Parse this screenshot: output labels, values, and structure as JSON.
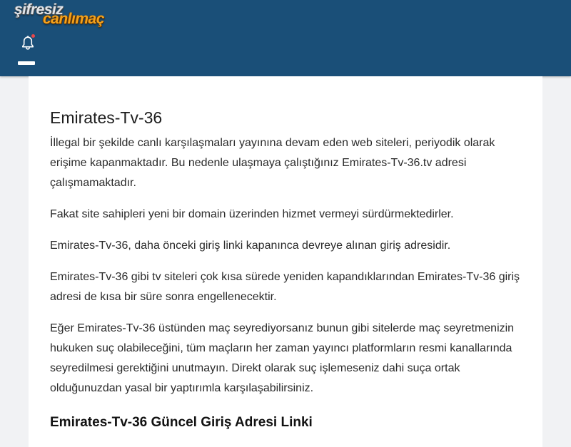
{
  "header": {
    "logo_line1": "şifresiz",
    "logo_line2": "canlımaç",
    "bell_icon": "bell-icon",
    "menu_icon": "hamburger-menu-icon",
    "colors": {
      "background": "#1a4f78",
      "notification_dot": "#e8474b"
    }
  },
  "article": {
    "title": "Emirates-Tv-36",
    "paragraphs": [
      "İllegal bir şekilde canlı karşılaşmaları yayınına devam eden web siteleri, periyodik olarak erişime kapanmaktadır. Bu nedenle ulaşmaya çalıştığınız Emirates-Tv-36.tv adresi çalışmamaktadır.",
      "Fakat site sahipleri yeni bir domain üzerinden hizmet vermeyi sürdürmektedirler.",
      "Emirates-Tv-36, daha önceki giriş linki kapanınca devreye alınan giriş adresidir.",
      "Emirates-Tv-36 gibi tv siteleri çok kısa sürede yeniden kapandıklarından Emirates-Tv-36 giriş adresi de kısa bir süre sonra engellenecektir.",
      "Eğer Emirates-Tv-36 üstünden maç seyrediyorsanız bunun gibi sitelerde maç seyretmenizin hukuken suç olabileceğini, tüm maçların her zaman yayıncı platformların resmi kanallarında seyredilmesi gerektiğini unutmayın. Direkt olarak suç işlemeseniz dahi suça ortak olduğunuzdan yasal bir yaptırımla karşılaşabilirsiniz."
    ],
    "subheading": "Emirates-Tv-36 Güncel Giriş Adresi Linki"
  }
}
